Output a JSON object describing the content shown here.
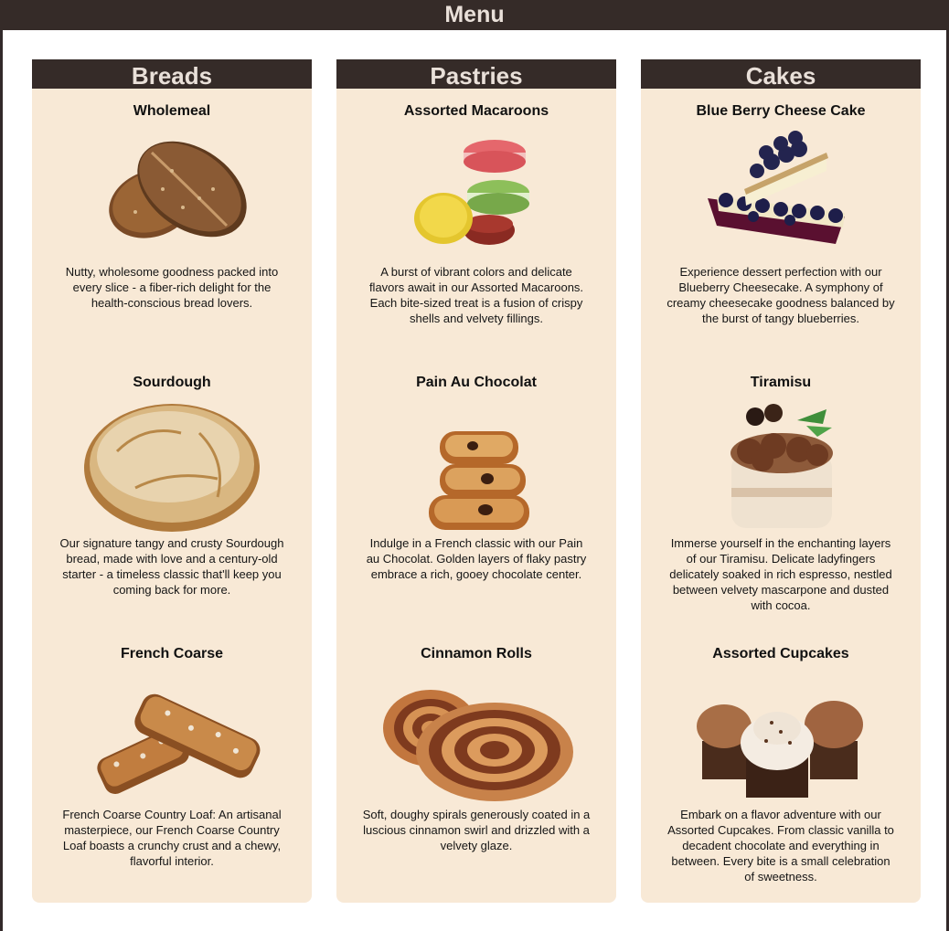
{
  "header": {
    "title": "Menu"
  },
  "columns": [
    {
      "title": "Breads",
      "items": [
        {
          "name": "Wholemeal",
          "description": "Nutty, wholesome goodness packed into every slice - a fiber-rich delight for the health-conscious bread lovers.",
          "icon": "wholemeal-bread-icon"
        },
        {
          "name": "Sourdough",
          "description": "Our signature tangy and crusty Sourdough bread, made with love and a century-old starter - a timeless classic that'll keep you coming back for more.",
          "icon": "sourdough-bread-icon"
        },
        {
          "name": "French Coarse",
          "description": "French Coarse Country Loaf: An artisanal masterpiece, our French Coarse Country Loaf boasts a crunchy crust and a chewy, flavorful interior.",
          "icon": "french-loaf-icon"
        }
      ]
    },
    {
      "title": "Pastries",
      "items": [
        {
          "name": "Assorted Macaroons",
          "description": "A burst of vibrant colors and delicate flavors await in our Assorted Macaroons. Each bite-sized treat is a fusion of crispy shells and velvety fillings.",
          "icon": "macaroons-icon"
        },
        {
          "name": "Pain Au Chocolat",
          "description": "Indulge in a French classic with our Pain au Chocolat. Golden layers of flaky pastry embrace a rich, gooey chocolate center.",
          "icon": "pain-au-chocolat-icon"
        },
        {
          "name": "Cinnamon Rolls",
          "description": "Soft, doughy spirals generously coated in a luscious cinnamon swirl and drizzled with a velvety glaze.",
          "icon": "cinnamon-rolls-icon"
        }
      ]
    },
    {
      "title": "Cakes",
      "items": [
        {
          "name": "Blue Berry Cheese Cake",
          "description": "Experience dessert perfection with our Blueberry Cheesecake. A symphony of creamy cheesecake goodness balanced by the burst of tangy blueberries.",
          "icon": "blueberry-cheesecake-icon"
        },
        {
          "name": "Tiramisu",
          "description": "Immerse yourself in the enchanting layers of our Tiramisu. Delicate ladyfingers delicately soaked in rich espresso, nestled between velvety mascarpone and dusted with cocoa.",
          "icon": "tiramisu-icon"
        },
        {
          "name": "Assorted Cupcakes",
          "description": "Embark on a flavor adventure with our Assorted Cupcakes. From classic vanilla to decadent chocolate and everything in between. Every bite is a small celebration of sweetness.",
          "icon": "cupcakes-icon"
        }
      ]
    }
  ],
  "colors": {
    "header_bg": "#352b28",
    "header_text": "#e9e0d9",
    "card_bg": "#f8e9d6"
  }
}
